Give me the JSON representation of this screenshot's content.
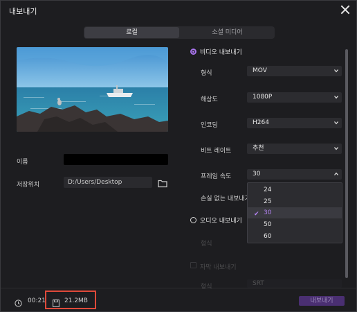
{
  "window": {
    "title": "내보내기"
  },
  "tabs": [
    {
      "label": "로컬",
      "active": true
    },
    {
      "label": "소셜 미디어",
      "active": false
    }
  ],
  "left": {
    "name_label": "이름",
    "name_value": "",
    "location_label": "저장위치",
    "location_value": "D:/Users/Desktop"
  },
  "video": {
    "section_label": "비디오 내보내기",
    "rows": [
      {
        "label": "형식",
        "value": "MOV"
      },
      {
        "label": "해상도",
        "value": "1080P"
      },
      {
        "label": "인코딩",
        "value": "H264"
      },
      {
        "label": "비트 레이트",
        "value": "추천"
      },
      {
        "label": "프레임 속도",
        "value": "30"
      }
    ],
    "lossless_label": "손실 없는 내보내기 우"
  },
  "framerate_dropdown": {
    "options": [
      "24",
      "25",
      "30",
      "50",
      "60"
    ],
    "selected": "30"
  },
  "audio": {
    "section_label": "오디오 내보내기",
    "format_label": "형식"
  },
  "subtitle": {
    "checkbox_label": "자막 내보내기",
    "format_label": "형식",
    "format_value": "SRT"
  },
  "footer": {
    "duration": "00:21",
    "file_size": "21.2MB",
    "export_button": "내보내기"
  },
  "colors": {
    "accent": "#a874ec",
    "highlight": "#e04a3a",
    "background": "#1d1d20"
  }
}
